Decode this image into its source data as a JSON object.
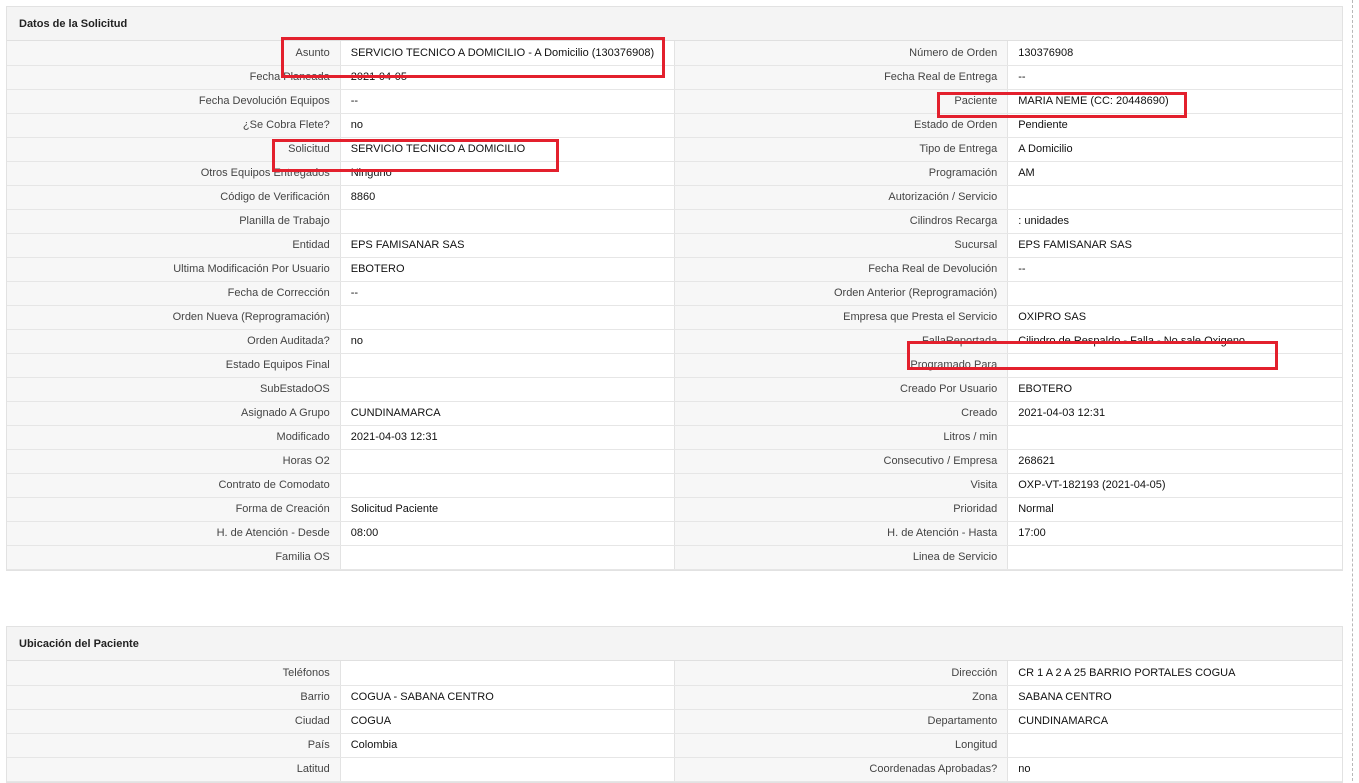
{
  "solicitud": {
    "title": "Datos de la Solicitud",
    "rows": [
      {
        "l1": "Asunto",
        "v1": "SERVICIO TECNICO A DOMICILIO - A Domicilio (130376908)",
        "l2": "Número de Orden",
        "v2": "130376908"
      },
      {
        "l1": "Fecha Planeada",
        "v1": "2021-04-05",
        "l2": "Fecha Real de Entrega",
        "v2": "--"
      },
      {
        "l1": "Fecha Devolución Equipos",
        "v1": "--",
        "l2": "Paciente",
        "v2": "MARIA NEME (CC: 20448690)"
      },
      {
        "l1": "¿Se Cobra Flete?",
        "v1": "no",
        "l2": "Estado de Orden",
        "v2": "Pendiente"
      },
      {
        "l1": "Solicitud",
        "v1": "SERVICIO TECNICO A DOMICILIO",
        "l2": "Tipo de Entrega",
        "v2": "A Domicilio"
      },
      {
        "l1": "Otros Equipos Entregados",
        "v1": "Ninguno",
        "l2": "Programación",
        "v2": "AM"
      },
      {
        "l1": "Código de Verificación",
        "v1": "8860",
        "l2": "Autorización / Servicio",
        "v2": ""
      },
      {
        "l1": "Planilla de Trabajo",
        "v1": "",
        "l2": "Cilindros Recarga",
        "v2": ": unidades"
      },
      {
        "l1": "Entidad",
        "v1": "EPS FAMISANAR SAS",
        "l2": "Sucursal",
        "v2": "EPS FAMISANAR SAS"
      },
      {
        "l1": "Ultima Modificación Por Usuario",
        "v1": "EBOTERO",
        "l2": "Fecha Real de Devolución",
        "v2": "--"
      },
      {
        "l1": "Fecha de Corrección",
        "v1": "--",
        "l2": "Orden Anterior (Reprogramación)",
        "v2": ""
      },
      {
        "l1": "Orden Nueva (Reprogramación)",
        "v1": "",
        "l2": "Empresa que Presta el Servicio",
        "v2": "OXIPRO SAS"
      },
      {
        "l1": "Orden Auditada?",
        "v1": "no",
        "l2": "FallaReportada",
        "v2": "Cilindro de Respaldo - Falla - No sale Oxigeno"
      },
      {
        "l1": "Estado Equipos Final",
        "v1": "",
        "l2": "Programado Para",
        "v2": ""
      },
      {
        "l1": "SubEstadoOS",
        "v1": "",
        "l2": "Creado Por Usuario",
        "v2": "EBOTERO"
      },
      {
        "l1": "Asignado A Grupo",
        "v1": "CUNDINAMARCA",
        "l2": "Creado",
        "v2": "2021-04-03 12:31"
      },
      {
        "l1": "Modificado",
        "v1": "2021-04-03 12:31",
        "l2": "Litros / min",
        "v2": ""
      },
      {
        "l1": "Horas O2",
        "v1": "",
        "l2": "Consecutivo / Empresa",
        "v2": "268621"
      },
      {
        "l1": "Contrato de Comodato",
        "v1": "",
        "l2": "Visita",
        "v2": "OXP-VT-182193 (2021-04-05)"
      },
      {
        "l1": "Forma de Creación",
        "v1": "Solicitud Paciente",
        "l2": "Prioridad",
        "v2": "Normal"
      },
      {
        "l1": "H. de Atención - Desde",
        "v1": "08:00",
        "l2": "H. de Atención - Hasta",
        "v2": "17:00"
      },
      {
        "l1": "Familia OS",
        "v1": "",
        "l2": "Linea de Servicio",
        "v2": ""
      }
    ]
  },
  "ubicacion": {
    "title": "Ubicación del Paciente",
    "rows": [
      {
        "l1": "Teléfonos",
        "v1": "",
        "l2": "Dirección",
        "v2": "CR 1 A 2 A 25 BARRIO PORTALES COGUA"
      },
      {
        "l1": "Barrio",
        "v1": "COGUA - SABANA CENTRO",
        "l2": "Zona",
        "v2": "SABANA CENTRO"
      },
      {
        "l1": "Ciudad",
        "v1": "COGUA",
        "l2": "Departamento",
        "v2": "CUNDINAMARCA"
      },
      {
        "l1": "País",
        "v1": "Colombia",
        "l2": "Longitud",
        "v2": ""
      },
      {
        "l1": "Latitud",
        "v1": "",
        "l2": "Coordenadas Aprobadas?",
        "v2": "no"
      }
    ]
  },
  "colors": {
    "highlight": "#e3202d",
    "header_bg": "#f4f4f4",
    "label_bg": "#f7f7f7"
  }
}
